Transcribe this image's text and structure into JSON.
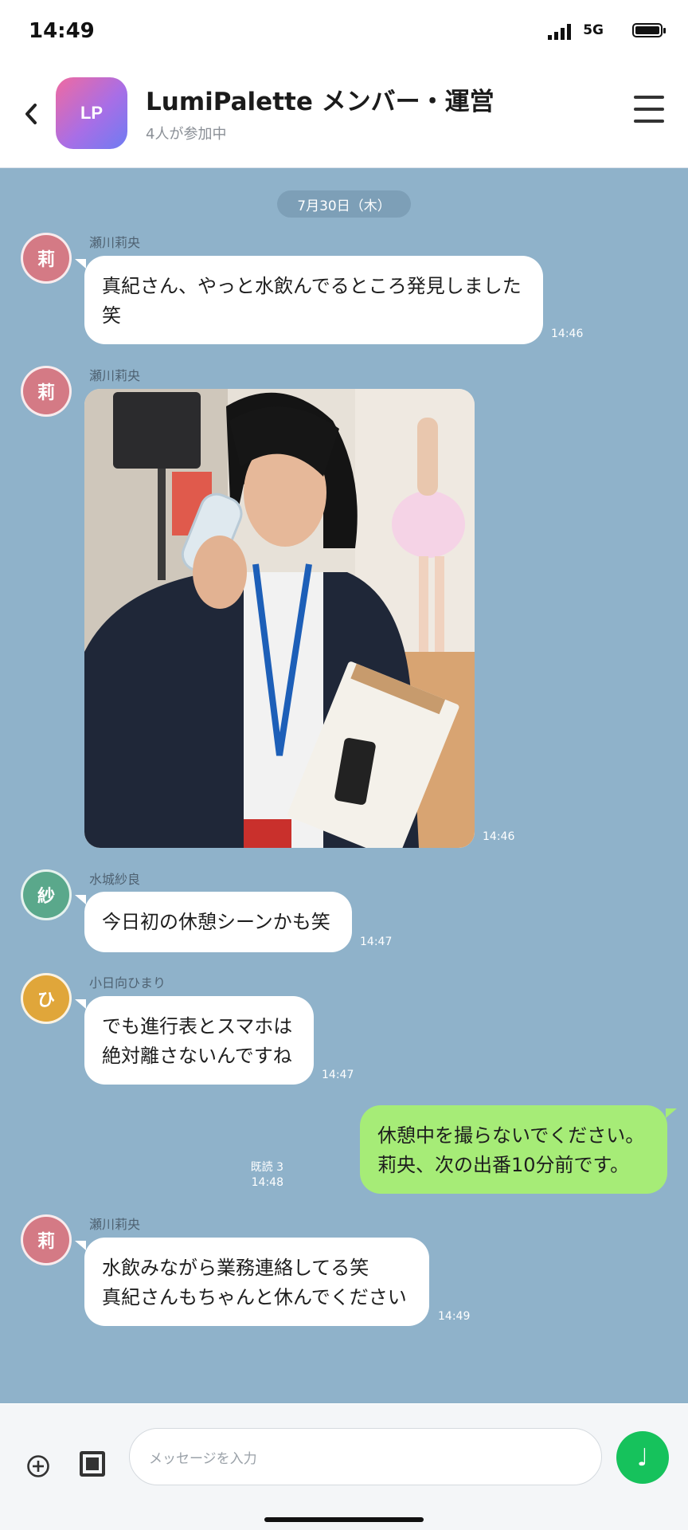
{
  "status": {
    "time": "14:49",
    "network": "5G"
  },
  "header": {
    "back_icon": "chevron-left-icon",
    "avatar_text": "LP",
    "title": "LumiPalette メンバー・運営",
    "subtitle": "4人が参加中",
    "menu_icon": "hamburger-menu-icon"
  },
  "chat": {
    "date": "7月30日（木）",
    "messages": [
      {
        "sender": "瀬川莉央",
        "avatar": "莉",
        "avatar_color": "#d47a85",
        "text": "真紀さん、やっと水飲んでるところ発見しました\n笑",
        "time": "14:46"
      },
      {
        "sender": "瀬川莉央",
        "avatar": "莉",
        "avatar_color": "#d47a85",
        "image": "photo-staff-drinking-water",
        "time": "14:46"
      },
      {
        "sender": "水城紗良",
        "avatar": "紗",
        "avatar_color": "#5aa88b",
        "text": "今日初の休憩シーンかも笑",
        "time": "14:47"
      },
      {
        "sender": "小日向ひまり",
        "avatar": "ひ",
        "avatar_color": "#e0a63a",
        "text": "でも進行表とスマホは\n絶対離さないんですね",
        "time": "14:47"
      },
      {
        "sender": "me",
        "text": "休憩中を撮らないでください。\n莉央、次の出番10分前です。",
        "read": "既読 3",
        "time": "14:48",
        "bubble_color": "#a6ec77"
      },
      {
        "sender": "瀬川莉央",
        "avatar": "莉",
        "avatar_color": "#d47a85",
        "text": "水飲みながら業務連絡してる笑\n真紀さんもちゃんと休んでください",
        "time": "14:49"
      }
    ]
  },
  "input": {
    "placeholder": "メッセージを入力",
    "plus_icon": "plus-circle-icon",
    "image_icon": "image-icon",
    "send_icon": "music-note-icon",
    "send_color": "#16c25c"
  },
  "colors": {
    "chat_bg": "#8fb2ca",
    "accent": "#16c25c"
  }
}
